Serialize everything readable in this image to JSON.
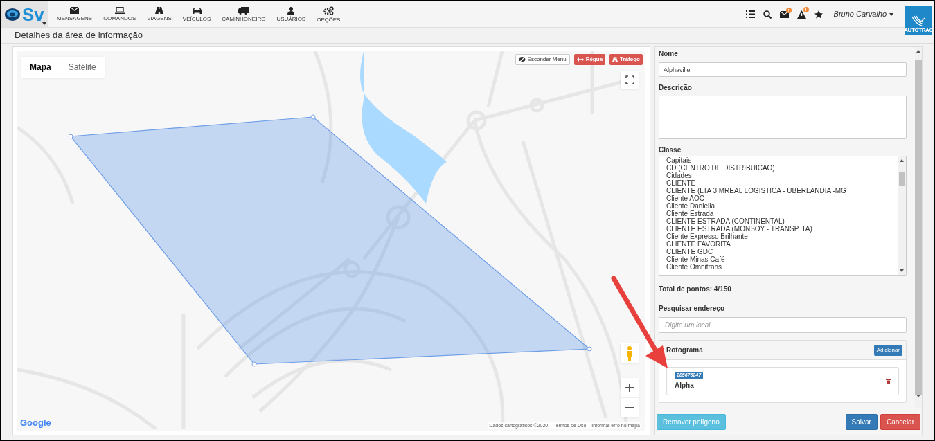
{
  "nav": {
    "logo": "Sv",
    "menu": [
      {
        "label": "MENSAGENS",
        "kind": "envelope"
      },
      {
        "label": "COMANDOS",
        "kind": "laptop"
      },
      {
        "label": "VIAGENS",
        "kind": "road"
      },
      {
        "label": "VEÍCULOS",
        "kind": "car"
      },
      {
        "label": "CAMINHONEIRO",
        "kind": "truck"
      },
      {
        "label": "USUÁRIOS",
        "kind": "user"
      },
      {
        "label": "OPÇÕES",
        "kind": "gears"
      }
    ],
    "tools": [
      {
        "kind": "list"
      },
      {
        "kind": "search"
      },
      {
        "kind": "envelope",
        "badge": "!"
      },
      {
        "kind": "warning",
        "badge": "!"
      },
      {
        "kind": "star"
      }
    ],
    "user": "Bruno Carvalho",
    "brand": "AUTOTRAC"
  },
  "page_title": "Detalhes da área de informação",
  "map": {
    "tabs": [
      {
        "label": "Mapa",
        "selected": true
      },
      {
        "label": "Satélite",
        "selected": false
      }
    ],
    "buttons": [
      {
        "label": "Esconder Menu",
        "kind": "plain"
      },
      {
        "label": "Régua",
        "kind": "ruler"
      },
      {
        "label": "Tráfego",
        "kind": "traffic"
      }
    ],
    "logo": "Google",
    "attribution": [
      "Dados cartográficos ©2020",
      "Termos de Uso",
      "Informar erro no mapa"
    ]
  },
  "form": {
    "name": {
      "label": "Nome",
      "value": "Alphaville"
    },
    "description": {
      "label": "Descrição"
    },
    "class": {
      "label": "Classe",
      "options": [
        "Capitais",
        "CD (CENTRO DE DISTRIBUICAO)",
        "Cidades",
        "CLIENTE",
        "CLIENTE (LTA 3 MREAL LOGISTICA - UBERLANDIA -MG",
        "Cliente AOC",
        "Cliente Daniella",
        "Cliente Estrada",
        "CLIENTE ESTRADA (CONTINENTAL)",
        "CLIENTE ESTRADA (MONSOY - TRANSP. TA)",
        "Cliente Expresso Brilhante",
        "CLIENTE FAVORITA",
        "CLIENTE GDC",
        "Cliente Minas Café",
        "Cliente Omnitrans"
      ]
    },
    "total": "Total de pontos: 4/150",
    "address": {
      "label": "Pesquisar endereço",
      "placeholder": "Digite um local"
    },
    "rotograma": {
      "title": "Rotograma",
      "add": "Adicionar",
      "items": [
        {
          "code": "285676247",
          "name": "Alpha"
        }
      ]
    },
    "buttons": [
      {
        "label": "Remover polígono",
        "kind": "info"
      },
      {
        "label": "Salvar",
        "kind": "primary"
      },
      {
        "label": "Cancelar",
        "kind": "danger"
      }
    ]
  }
}
